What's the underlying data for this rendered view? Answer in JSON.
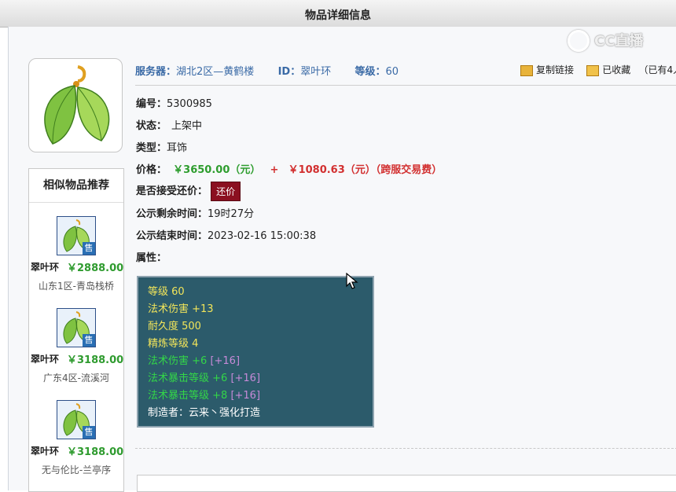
{
  "window": {
    "title": "物品详细信息"
  },
  "watermark": {
    "text": "CC直播"
  },
  "item": {
    "server_label": "服务器：",
    "server": "湖北2区—黄鹤楼",
    "id_label": "ID：",
    "id": "翠叶环",
    "level_label": "等级：",
    "level": "60",
    "number_label": "编号：",
    "number": "5300985",
    "status_label": "状态：",
    "status": "上架中",
    "type_label": "类型：",
    "type": "耳饰",
    "price_label": "价格：",
    "price_main": "￥3650.00（元）",
    "price_plus": "+",
    "price_fee": "￥1080.63（元）（跨服交易费）",
    "bargain_label": "是否接受还价：",
    "bargain_button": "还价",
    "remain_label": "公示剩余时间：",
    "remain": "19时27分",
    "end_label": "公示结束时间：",
    "end": "2023-02-16 15:00:38",
    "attr_label": "属性："
  },
  "actions": {
    "copy_link": "复制链接",
    "favorited": "已收藏",
    "fav_count": "（已有4人"
  },
  "attributes": [
    {
      "text": "等级 60",
      "color": "#f2e55a"
    },
    {
      "text": "法术伤害 +13",
      "color": "#f2e55a"
    },
    {
      "text": "耐久度 500",
      "color": "#f2e55a"
    },
    {
      "text": "精炼等级 4",
      "color": "#f2e55a"
    },
    {
      "text": "法术伤害 +6",
      "extra": "[+16]",
      "color": "#33d648"
    },
    {
      "text": "法术暴击等级 +6",
      "extra": "[+16]",
      "color": "#33d648"
    },
    {
      "text": "法术暴击等级 +8",
      "extra": "[+16]",
      "color": "#33d648"
    },
    {
      "text": "制造者：云来丶强化打造",
      "color": "#ffffff"
    }
  ],
  "similar": {
    "title": "相似物品推荐",
    "sold_badge": "售",
    "items": [
      {
        "name": "翠叶环",
        "price": "￥2888.00",
        "server": "山东1区-青岛栈桥"
      },
      {
        "name": "翠叶环",
        "price": "￥3188.00",
        "server": "广东4区-流溪河"
      },
      {
        "name": "翠叶环",
        "price": "￥3188.00",
        "server": "无与伦比-兰亭序"
      }
    ]
  }
}
